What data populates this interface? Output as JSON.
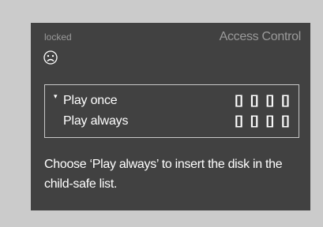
{
  "header": {
    "status": "locked",
    "status_icon": "sad-face-icon",
    "title": "Access Control"
  },
  "menu": {
    "cursor": "▾",
    "items": [
      {
        "label": "Play once",
        "slots": [
          "[]",
          "[]",
          "[]",
          "[]"
        ]
      },
      {
        "label": "Play always",
        "slots": [
          "[]",
          "[]",
          "[]",
          "[]"
        ]
      }
    ]
  },
  "hint": "Choose ‘Play always’ to insert the disk in the child-safe list.",
  "colors": {
    "background": "#cbcbcb",
    "panel": "#414141",
    "text": "#ffffff",
    "muted": "#9a9a9a",
    "border": "#c8c8c8"
  }
}
